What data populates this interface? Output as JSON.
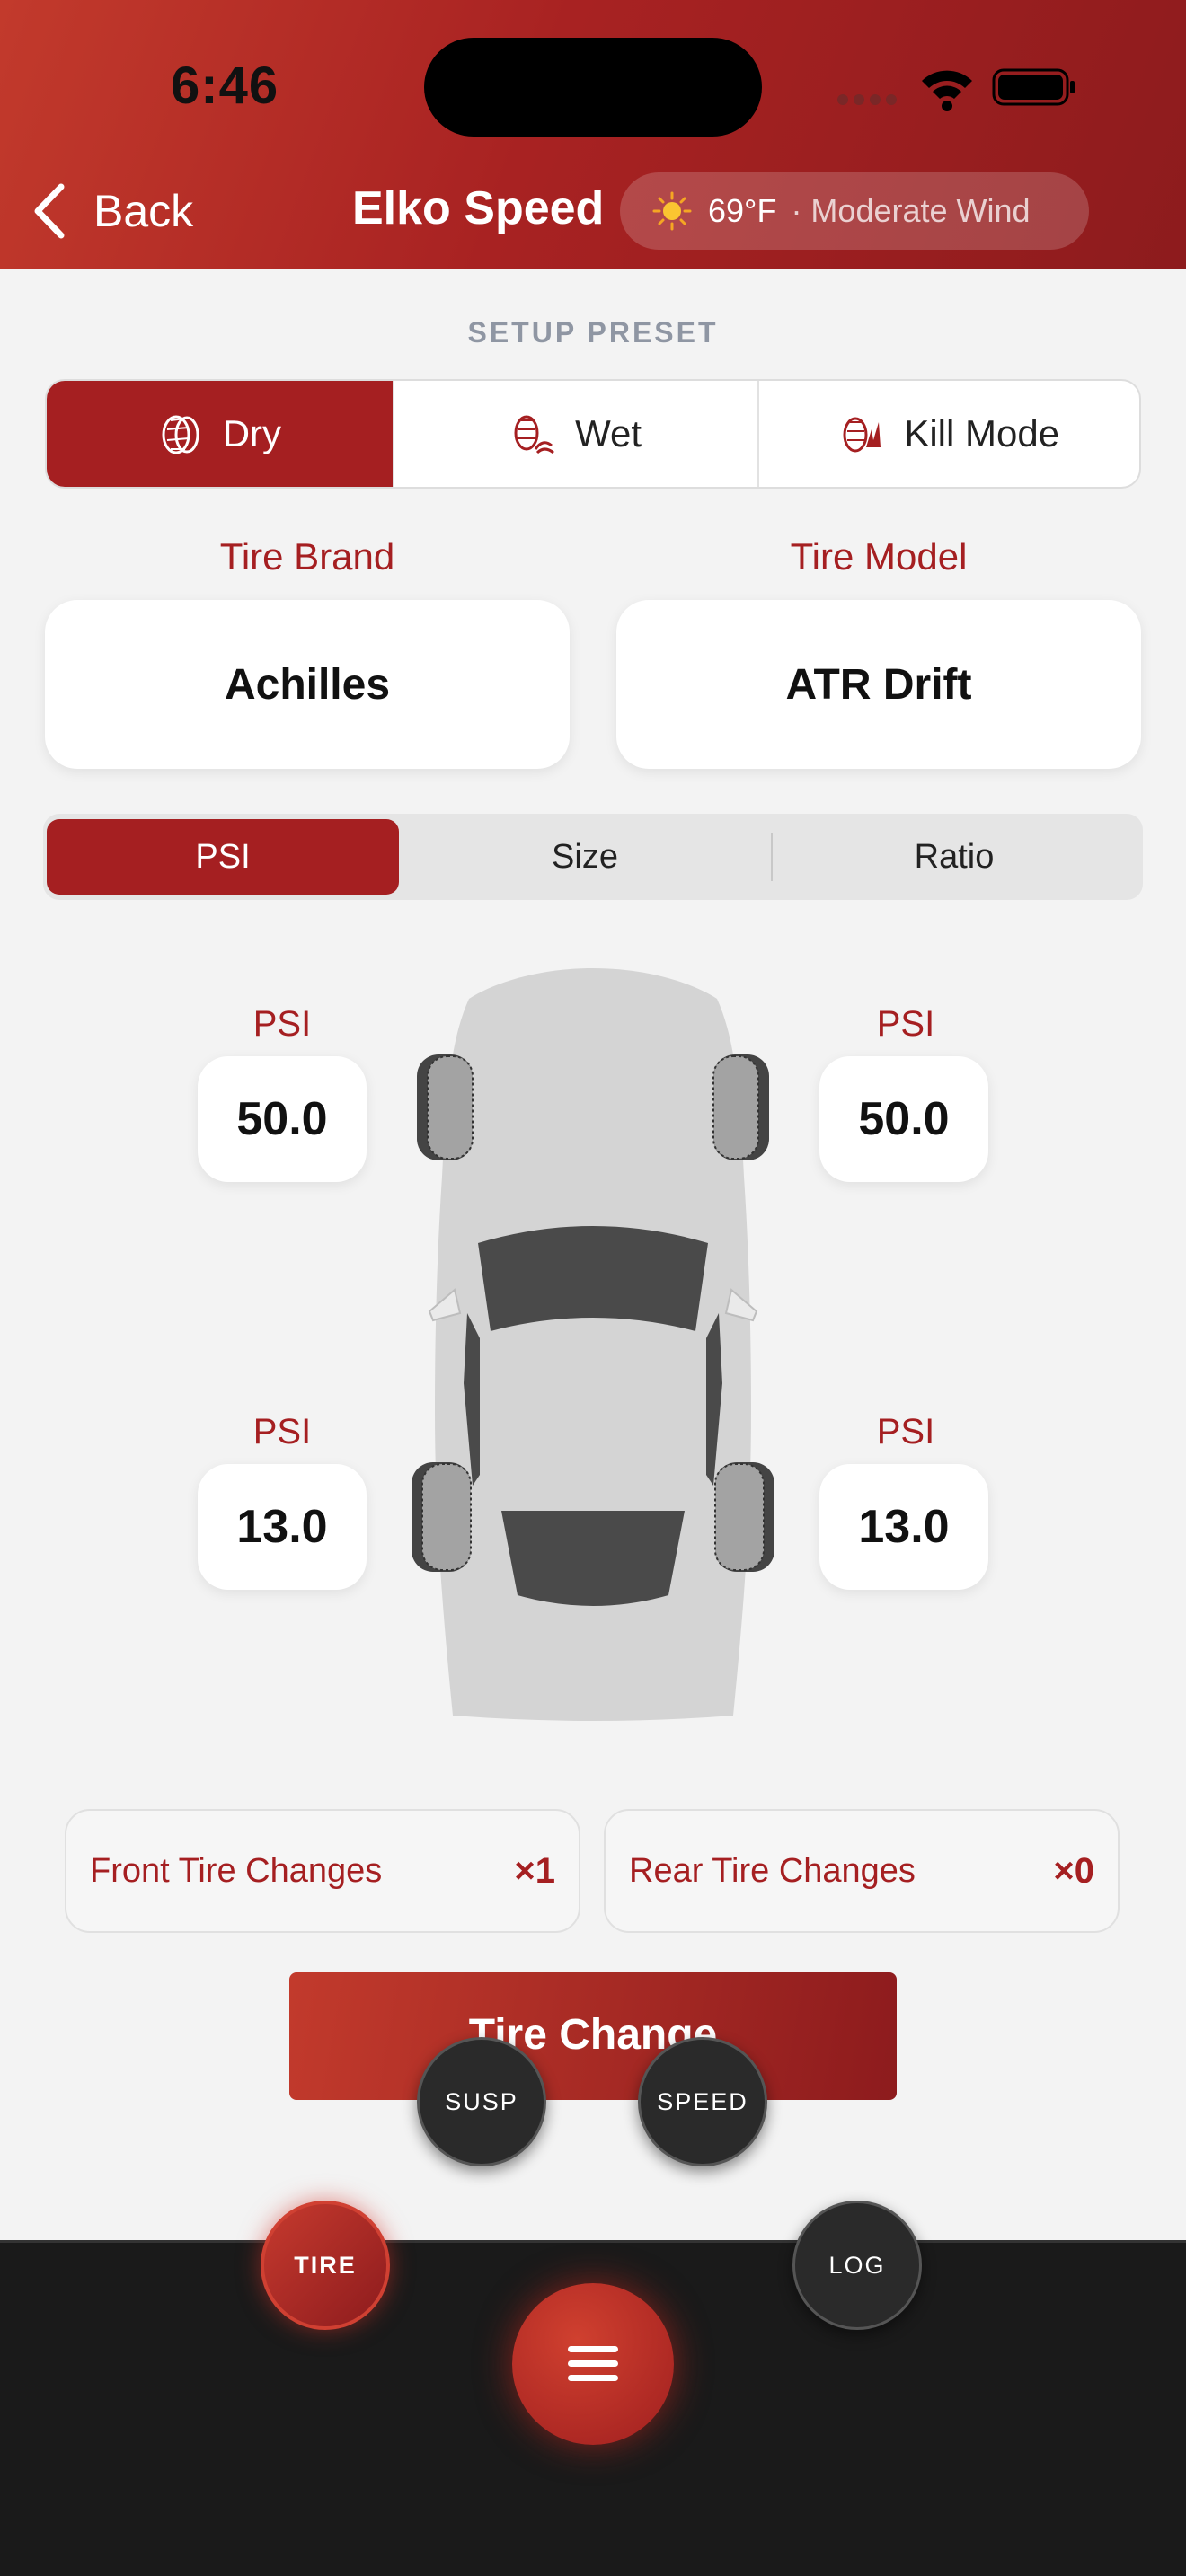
{
  "status_bar": {
    "time": "6:46"
  },
  "nav": {
    "back_label": "Back",
    "title": "Elko Speed"
  },
  "weather": {
    "temperature": "69°F",
    "condition": "· Moderate Wind"
  },
  "setup_preset": {
    "label": "SETUP PRESET",
    "options": [
      {
        "label": "Dry",
        "active": true
      },
      {
        "label": "Wet",
        "active": false
      },
      {
        "label": "Kill Mode",
        "active": false
      }
    ]
  },
  "tire": {
    "brand_label": "Tire Brand",
    "brand_value": "Achilles",
    "model_label": "Tire Model",
    "model_value": "ATR Drift"
  },
  "unit_tabs": [
    {
      "label": "PSI",
      "active": true
    },
    {
      "label": "Size",
      "active": false
    },
    {
      "label": "Ratio",
      "active": false
    }
  ],
  "wheels": {
    "front_left": {
      "label": "PSI",
      "value": "50.0"
    },
    "front_right": {
      "label": "PSI",
      "value": "50.0"
    },
    "rear_left": {
      "label": "PSI",
      "value": "13.0"
    },
    "rear_right": {
      "label": "PSI",
      "value": "13.0"
    }
  },
  "changes": {
    "front_label": "Front Tire Changes",
    "front_count": "×1",
    "rear_label": "Rear Tire Changes",
    "rear_count": "×0"
  },
  "tire_change_button": "Tire Change",
  "fab_menu": {
    "susp": "SUSP",
    "speed": "SPEED",
    "tire": "TIRE",
    "log": "LOG"
  },
  "colors": {
    "accent": "#a51f21",
    "header_start": "#c23a2c",
    "header_end": "#8d1b1d"
  }
}
